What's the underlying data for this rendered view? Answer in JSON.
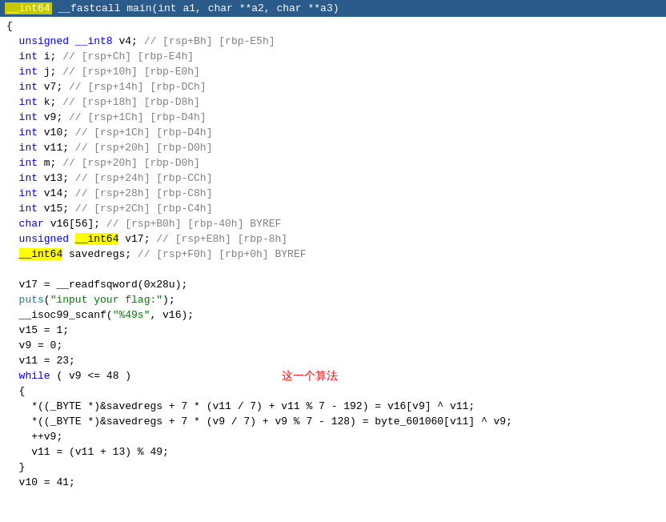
{
  "header": {
    "prefix": " ",
    "int64": "__int64",
    "suffix": " __fastcall main(int a1, char **a2, char **a3)"
  },
  "lines": [
    {
      "indent": 0,
      "content": "{",
      "type": "brace"
    },
    {
      "indent": 2,
      "content": "unsigned __int8 v4; // [rsp+Bh] [rbp-E5h]",
      "type": "decl_unsigned8"
    },
    {
      "indent": 2,
      "content": "int i; // [rsp+Ch] [rbp-E4h]",
      "type": "decl_int"
    },
    {
      "indent": 2,
      "content": "int j; // [rsp+10h] [rbp-E0h]",
      "type": "decl_int"
    },
    {
      "indent": 2,
      "content": "int v7; // [rsp+14h] [rbp-DCh]",
      "type": "decl_int"
    },
    {
      "indent": 2,
      "content": "int k; // [rsp+18h] [rbp-D8h]",
      "type": "decl_int"
    },
    {
      "indent": 2,
      "content": "int v9; // [rsp+1Ch] [rbp-D4h]",
      "type": "decl_int"
    },
    {
      "indent": 2,
      "content": "int v10; // [rsp+1Ch] [rbp-D4h]",
      "type": "decl_int"
    },
    {
      "indent": 2,
      "content": "int v11; // [rsp+20h] [rbp-D0h]",
      "type": "decl_int"
    },
    {
      "indent": 2,
      "content": "int m; // [rsp+20h] [rbp-D0h]",
      "type": "decl_int"
    },
    {
      "indent": 2,
      "content": "int v13; // [rsp+24h] [rbp-CCh]",
      "type": "decl_int"
    },
    {
      "indent": 2,
      "content": "int v14; // [rsp+28h] [rbp-C8h]",
      "type": "decl_int"
    },
    {
      "indent": 2,
      "content": "int v15; // [rsp+2Ch] [rbp-C4h]",
      "type": "decl_int"
    },
    {
      "indent": 2,
      "content": "char v16[56]; // [rsp+B0h] [rbp-40h] BYREF",
      "type": "decl_char"
    },
    {
      "indent": 2,
      "content": "unsigned __int64 v17; // [rsp+E8h] [rbp-8h]",
      "type": "decl_unsigned_int64"
    },
    {
      "indent": 2,
      "content": "__int64 savedregs; // [rsp+F0h] [rbp+0h] BYREF",
      "type": "decl_int64"
    },
    {
      "indent": 0,
      "content": "",
      "type": "blank"
    },
    {
      "indent": 2,
      "content": "v17 = __readfsqword(0x28u);",
      "type": "code"
    },
    {
      "indent": 2,
      "content": "puts(\"input your flag:\");",
      "type": "code_puts"
    },
    {
      "indent": 2,
      "content": "__isoc99_scanf(\"%49s\", v16);",
      "type": "code"
    },
    {
      "indent": 2,
      "content": "v15 = 1;",
      "type": "code"
    },
    {
      "indent": 2,
      "content": "v9 = 0;",
      "type": "code"
    },
    {
      "indent": 2,
      "content": "v11 = 23;",
      "type": "code"
    },
    {
      "indent": 2,
      "content": "while ( v9 <= 48 )",
      "type": "while_line",
      "comment_pos": true
    },
    {
      "indent": 2,
      "content": "{",
      "type": "brace_inner"
    },
    {
      "indent": 4,
      "content": "*((_BYTE *)&savedregs + 7 * (v11 / 7) + v11 % 7 - 192) = v16[v9] ^ v11;",
      "type": "code_long"
    },
    {
      "indent": 4,
      "content": "*((_BYTE *)&savedregs + 7 * (v9 / 7) + v9 % 7 - 128) = byte_601060[v11] ^ v9;",
      "type": "code_long2"
    },
    {
      "indent": 4,
      "content": "++v9;",
      "type": "code"
    },
    {
      "indent": 4,
      "content": "v11 = (v11 + 13) % 49;",
      "type": "code"
    },
    {
      "indent": 2,
      "content": "}",
      "type": "brace_close"
    },
    {
      "indent": 2,
      "content": "v10 = 41;",
      "type": "code"
    }
  ],
  "annotation": {
    "text": "这一个算法",
    "color": "#ff0000"
  }
}
